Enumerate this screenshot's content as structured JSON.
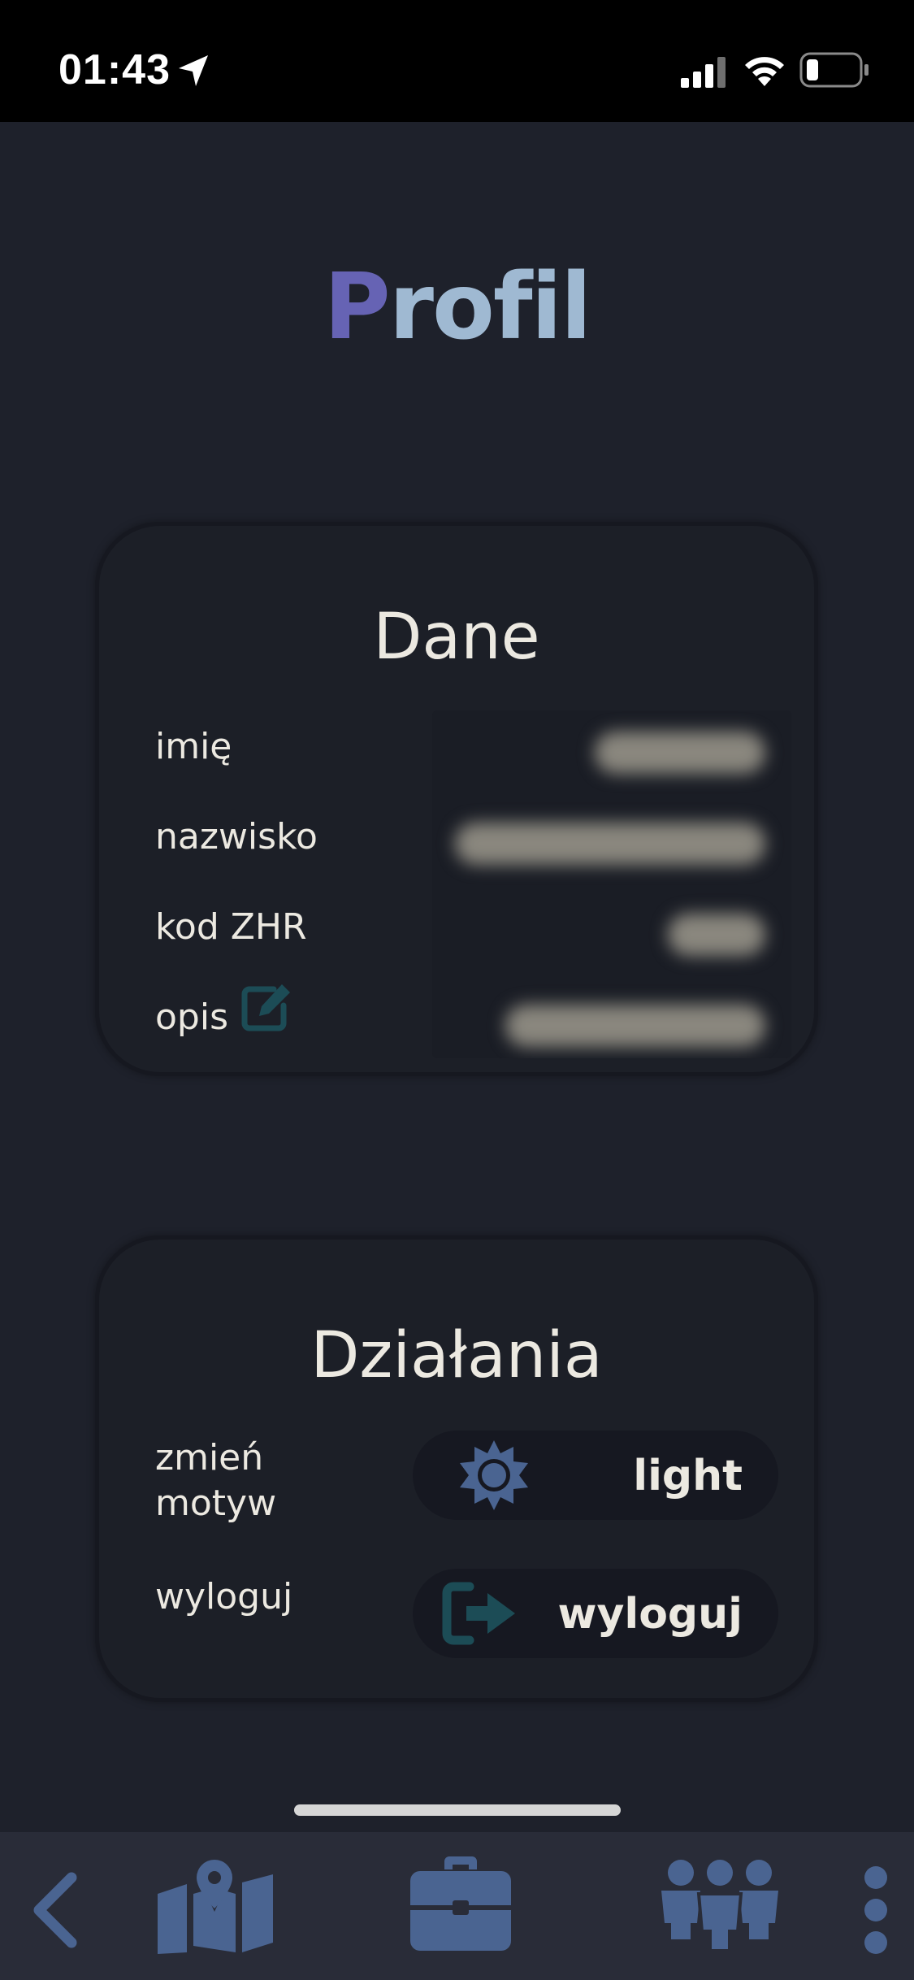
{
  "status_bar": {
    "time": "01:43",
    "icons": [
      "location-arrow-icon",
      "cellular-signal-icon",
      "wifi-icon",
      "battery-icon"
    ]
  },
  "header": {
    "title_first_letter": "P",
    "title_rest": "rofil"
  },
  "dane": {
    "title": "Dane",
    "fields": [
      {
        "label": "imię"
      },
      {
        "label": "nazwisko"
      },
      {
        "label": "kod ZHR"
      },
      {
        "label": "opis"
      }
    ],
    "edit_icon": "edit-icon"
  },
  "dzialania": {
    "title": "Działania",
    "theme_label": "zmień motyw",
    "theme_label_line1": "zmień",
    "theme_label_line2": "motyw",
    "theme_button": "light",
    "logout_label": "wyloguj",
    "logout_button": "wyloguj"
  },
  "bottom_nav": {
    "items": [
      "back-icon",
      "map-icon",
      "briefcase-icon",
      "group-icon",
      "more-vertical-icon"
    ]
  },
  "colors": {
    "background": "#1e212b",
    "card": "#1c1f27",
    "title_accent": "#6663b4",
    "title_secondary": "#9fb9d2",
    "icon": "#4a6491",
    "text": "#ece9e1",
    "nav_bar": "#292c38"
  }
}
